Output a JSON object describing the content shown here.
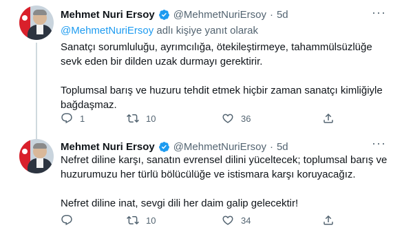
{
  "tweets": [
    {
      "name": "Mehmet Nuri Ersoy",
      "handle": "@MehmetNuriErsoy",
      "dot": "·",
      "time": "5d",
      "reply_to": {
        "user": "@MehmetNuriErsoy",
        "suffix": " adlı kişiye yanıt olarak"
      },
      "paragraphs": [
        "Sanatçı sorumluluğu, ayrımcılığa, ötekileştirmeye, tahammülsüzlüğe sevk eden bir dilden uzak durmayı gerektirir.",
        "Toplumsal barış ve huzuru tehdit etmek hiçbir zaman sanatçı kimliğiyle bağdaşmaz."
      ],
      "replies": "1",
      "retweets": "10",
      "likes": "36"
    },
    {
      "name": "Mehmet Nuri Ersoy",
      "handle": "@MehmetNuriErsoy",
      "dot": "·",
      "time": "5d",
      "paragraphs": [
        "Nefret diline karşı, sanatın evrensel dilini yüceltecek; toplumsal barış ve huzurumuzu her türlü bölücülüğe ve istismara karşı koruyacağız.",
        "Nefret diline inat, sevgi dili her daim galip gelecektir!"
      ],
      "replies": "",
      "retweets": "10",
      "likes": "34"
    }
  ],
  "icons": {
    "more": "more-icon",
    "verified": "verified-badge-icon",
    "reply": "reply-icon",
    "retweet": "retweet-icon",
    "like": "like-icon",
    "share": "share-icon"
  },
  "colors": {
    "verified": "#1d9bf0",
    "link": "#1d9bf0",
    "muted": "#536471",
    "thread_line": "#cfd9de"
  }
}
